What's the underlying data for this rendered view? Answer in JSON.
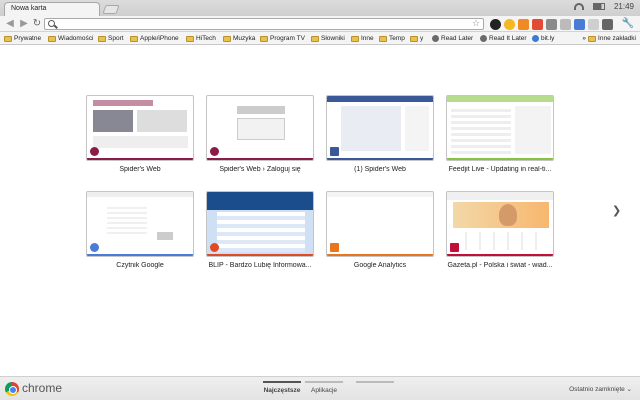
{
  "tab": {
    "title": "Nowa karta"
  },
  "system": {
    "time": "21:49"
  },
  "omnibox": {
    "value": "",
    "placeholder": ""
  },
  "bookmarks": [
    {
      "label": "Prywatne",
      "type": "folder"
    },
    {
      "label": "Wiadomości",
      "type": "folder"
    },
    {
      "label": "Sport",
      "type": "folder"
    },
    {
      "label": "Apple/iPhone",
      "type": "folder"
    },
    {
      "label": "HiTech",
      "type": "folder"
    },
    {
      "label": "Muzyka",
      "type": "folder"
    },
    {
      "label": "Program TV",
      "type": "folder"
    },
    {
      "label": "Słowniki",
      "type": "folder"
    },
    {
      "label": "Inne",
      "type": "folder"
    },
    {
      "label": "Temp",
      "type": "folder"
    },
    {
      "label": "y",
      "type": "folder"
    },
    {
      "label": "Read Later",
      "type": "page"
    },
    {
      "label": "Read It Later",
      "type": "page"
    },
    {
      "label": "bit.ly",
      "type": "page"
    }
  ],
  "other_bookmarks": "Inne zakładki",
  "thumbnails": [
    {
      "title": "Spider's Web",
      "accent": "#8b1b4a"
    },
    {
      "title": "Spider's Web › Zaloguj się",
      "accent": "#8b1b4a"
    },
    {
      "title": "(1) Spider's Web",
      "accent": "#3b5998"
    },
    {
      "title": "Feedjit Live - Updating in real-ti...",
      "accent": "#86c440"
    },
    {
      "title": "Czytnik Google",
      "accent": "#4a7bd6"
    },
    {
      "title": "BLIP - Bardzo Lubię Informowa...",
      "accent": "#e04a24"
    },
    {
      "title": "Google Analytics",
      "accent": "#e8761e"
    },
    {
      "title": "Gazeta.pl - Polska i świat - wiad...",
      "accent": "#c0103a"
    }
  ],
  "bottom": {
    "brand": "chrome",
    "tabs": [
      {
        "label": "Najczęstsze"
      },
      {
        "label": "Aplikacje"
      }
    ],
    "recently_closed": "Ostatnio zamknięte ⌄"
  }
}
